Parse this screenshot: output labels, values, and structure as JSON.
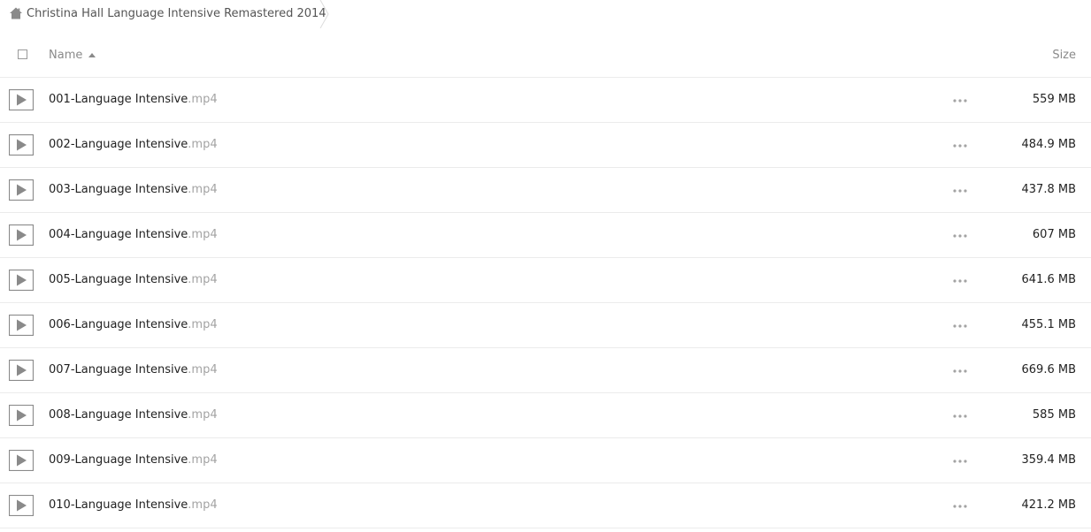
{
  "breadcrumb": {
    "folder": "Christina Hall Language Intensive Remastered 2014"
  },
  "header": {
    "name_label": "Name",
    "size_label": "Size"
  },
  "files": [
    {
      "name": "001-Language Intensive",
      "ext": ".mp4",
      "size": "559 MB"
    },
    {
      "name": "002-Language Intensive",
      "ext": ".mp4",
      "size": "484.9 MB"
    },
    {
      "name": "003-Language Intensive",
      "ext": ".mp4",
      "size": "437.8 MB"
    },
    {
      "name": "004-Language Intensive",
      "ext": ".mp4",
      "size": "607 MB"
    },
    {
      "name": "005-Language Intensive",
      "ext": ".mp4",
      "size": "641.6 MB"
    },
    {
      "name": "006-Language Intensive",
      "ext": ".mp4",
      "size": "455.1 MB"
    },
    {
      "name": "007-Language Intensive",
      "ext": ".mp4",
      "size": "669.6 MB"
    },
    {
      "name": "008-Language Intensive",
      "ext": ".mp4",
      "size": "585 MB"
    },
    {
      "name": "009-Language Intensive",
      "ext": ".mp4",
      "size": "359.4 MB"
    },
    {
      "name": "010-Language Intensive",
      "ext": ".mp4",
      "size": "421.2 MB"
    }
  ],
  "icons": {
    "home": "home-icon",
    "file": "play-icon",
    "actions": "more-icon",
    "sort": "sort-ascending-icon"
  },
  "colors": {
    "text": "#222222",
    "muted": "#8a8a8a",
    "extension": "#a3a3a3",
    "divider": "#ebebeb"
  }
}
